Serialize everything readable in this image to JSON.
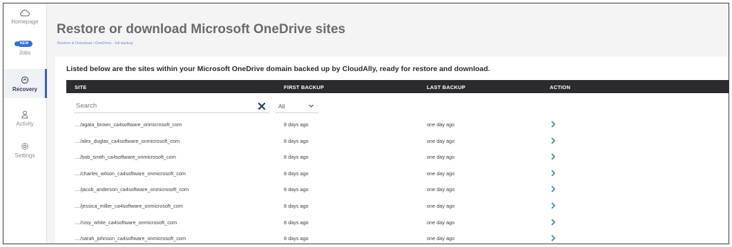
{
  "sidebar": {
    "items": [
      {
        "label": "Homepage",
        "icon": "cloud-icon",
        "active": false
      },
      {
        "label": "Jobs",
        "icon": "jobs-badge-icon",
        "badge": "NEW",
        "active": false
      },
      {
        "label": "Recovery",
        "icon": "recovery-icon",
        "active": true
      },
      {
        "label": "Activity",
        "icon": "user-icon",
        "active": false
      },
      {
        "label": "Settings",
        "icon": "gear-icon",
        "active": false
      }
    ]
  },
  "header": {
    "title": "Restore or download Microsoft OneDrive sites",
    "breadcrumb": {
      "root": "Restore & Download",
      "separator": " >",
      "middle": "OneDrive",
      "separator2": " - ",
      "current": "full backup"
    }
  },
  "main": {
    "intro": "Listed below are the sites within your Microsoft OneDrive domain backed up by CloudAlly, ready for restore and download.",
    "columns": {
      "site": "SITE",
      "first_backup": "FIRST BACKUP",
      "last_backup": "LAST BACKUP",
      "action": "ACTION"
    },
    "search_placeholder": "Search",
    "filter_value": "All",
    "rows": [
      {
        "site": "..../agata_brown_ca4software_onmicrosoft_com",
        "first": "8 days ago",
        "last": "one day ago"
      },
      {
        "site": "..../alex_duglas_ca4software_onmicrosoft_com",
        "first": "8 days ago",
        "last": "one day ago"
      },
      {
        "site": "..../bob_smith_ca4software_onmicrosoft_com",
        "first": "8 days ago",
        "last": "one day ago"
      },
      {
        "site": "..../charles_wilson_ca4software_onmicrosoft_com",
        "first": "8 days ago",
        "last": "one day ago"
      },
      {
        "site": "..../jacob_anderson_ca4software_onmicrosoft_com",
        "first": "8 days ago",
        "last": "one day ago"
      },
      {
        "site": "..../jessica_miller_ca4software_onmicrosoft_com",
        "first": "8 days ago",
        "last": "one day ago"
      },
      {
        "site": "..../rosy_white_ca4software_onmicrosoft_com",
        "first": "8 days ago",
        "last": "one day ago"
      },
      {
        "site": "..../sarah_johnson_ca4software_onmicrosoft_com",
        "first": "8 days ago",
        "last": "one day ago"
      }
    ]
  },
  "colors": {
    "accent": "#2f5bd8",
    "action_arrow": "#2f7fd0",
    "header_bar": "#2b2b2f",
    "clear_x": "#1f3b6b"
  }
}
